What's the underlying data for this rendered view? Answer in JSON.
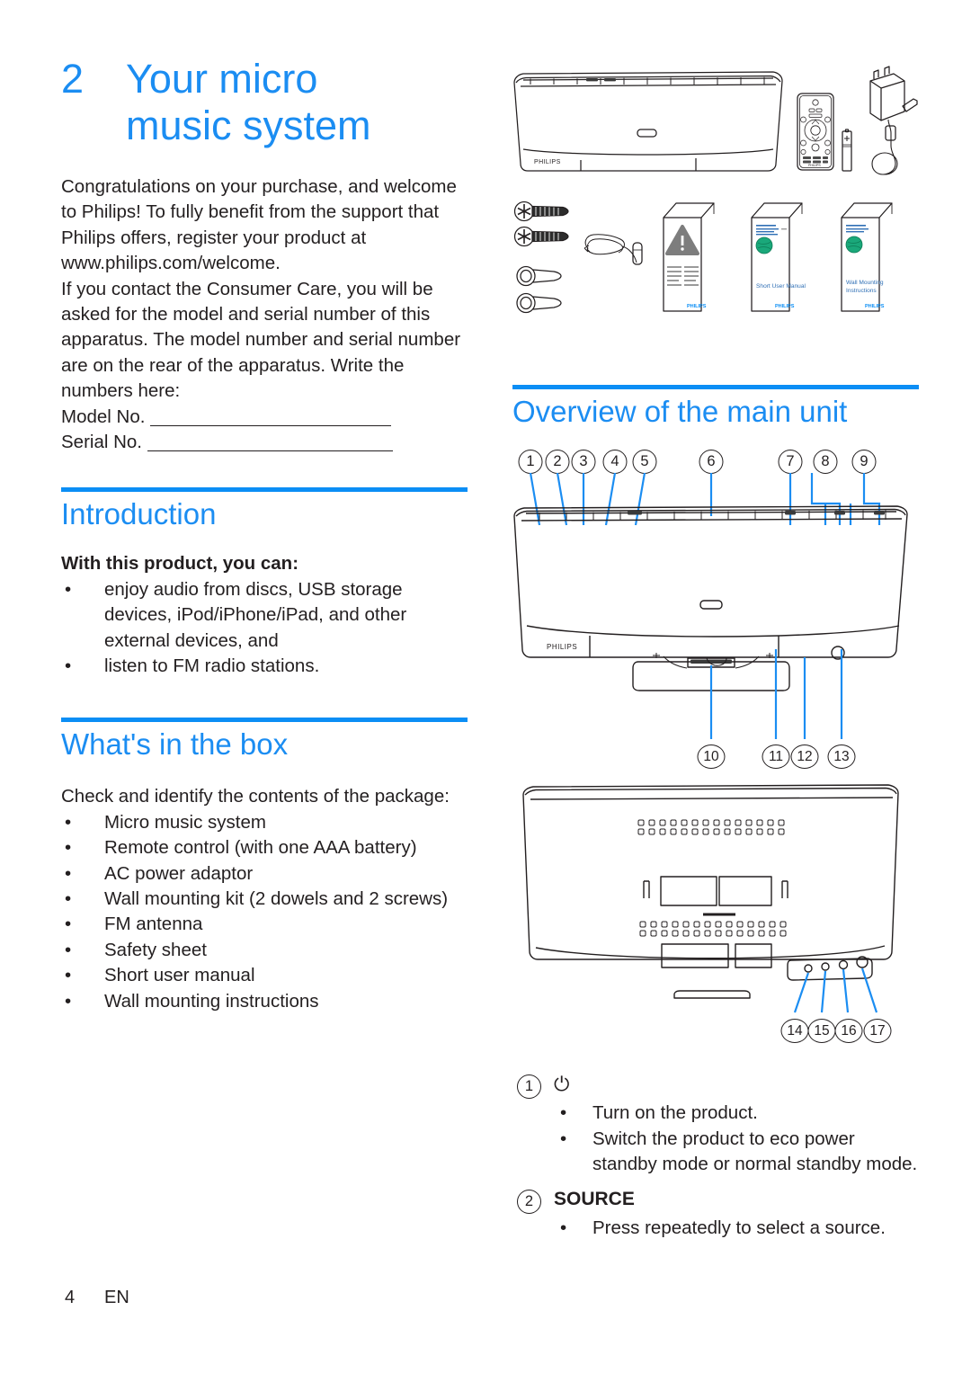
{
  "meta": {
    "accent_color": "#0b8ef5",
    "heading_color": "#1b8df2",
    "text_color": "#231f20"
  },
  "chapter": {
    "number": "2",
    "title_line1": "Your micro",
    "title_line2": "music system"
  },
  "intro_paragraphs": [
    "Congratulations on your purchase, and welcome to Philips! To fully benefit from the support that Philips offers, register your product at www.philips.com/welcome.",
    "If you contact the Consumer Care, you will be asked for the model and serial number of this apparatus. The model number and serial number are on the rear of the apparatus. Write the numbers here:"
  ],
  "fields": {
    "model_label": "Model No.",
    "serial_label": "Serial No.",
    "model_value": "",
    "serial_value": ""
  },
  "introduction": {
    "heading": "Introduction",
    "lead": "With this product, you can:",
    "bullets": [
      "enjoy audio from discs, USB storage devices, iPod/iPhone/iPad, and other external devices, and",
      "listen to FM radio stations."
    ]
  },
  "whats_in_box": {
    "heading": "What's in the box",
    "lead": "Check and identify the contents of the package:",
    "bullets": [
      "Micro music system",
      "Remote control (with one AAA battery)",
      "AC power adaptor",
      "Wall mounting kit (2 dowels and 2 screws)",
      "FM antenna",
      "Safety sheet",
      "Short user manual",
      "Wall mounting instructions"
    ]
  },
  "box_art": {
    "main_unit_brand": "PHILIPS",
    "remote_brand": "PHILIPS",
    "booklets": [
      {
        "name": "safety-sheet",
        "title": "",
        "brand": "PHILIPS"
      },
      {
        "name": "short-user-manual",
        "title": "Short User Manual",
        "brand": "PHILIPS"
      },
      {
        "name": "wall-mounting-instructions",
        "title": "Wall Mounting Instructions",
        "brand": "PHILIPS"
      }
    ]
  },
  "overview": {
    "heading": "Overview of the main unit",
    "front_callouts_top": [
      "1",
      "2",
      "3",
      "4",
      "5",
      "6",
      "7",
      "8",
      "9"
    ],
    "front_callouts_bottom": [
      "10",
      "11",
      "12",
      "13"
    ],
    "rear_callouts": [
      "14",
      "15",
      "16",
      "17"
    ],
    "unit_brand": "PHILIPS"
  },
  "keys": [
    {
      "number": "1",
      "symbol": "⏻",
      "label": "",
      "is_symbol": true,
      "bullets": [
        "Turn on the product.",
        "Switch the product to eco power standby mode or normal standby mode."
      ]
    },
    {
      "number": "2",
      "symbol": "",
      "label": "SOURCE",
      "is_symbol": false,
      "bullets": [
        "Press repeatedly to select a source."
      ]
    }
  ],
  "footer": {
    "page_number": "4",
    "language": "EN"
  }
}
